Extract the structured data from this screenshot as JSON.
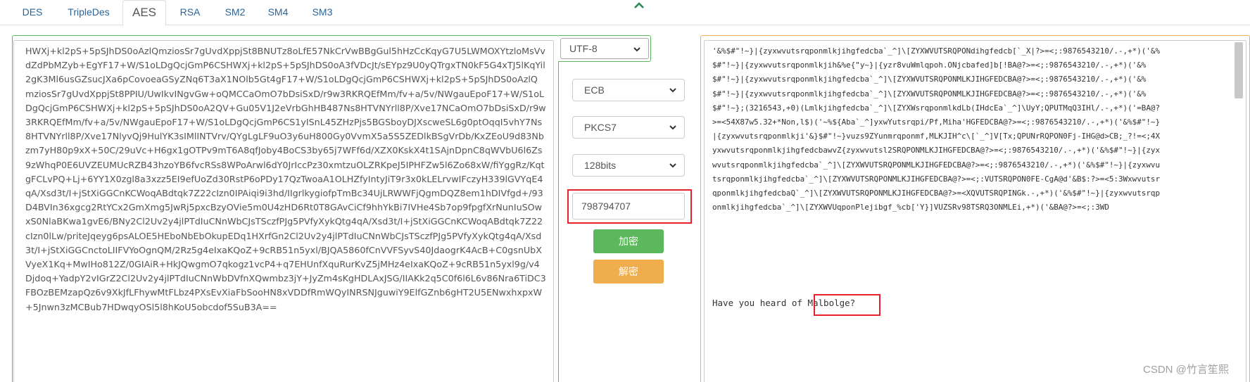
{
  "tabs": [
    {
      "label": "DES"
    },
    {
      "label": "TripleDes"
    },
    {
      "label": "AES",
      "active": true
    },
    {
      "label": "RSA"
    },
    {
      "label": "SM2"
    },
    {
      "label": "SM4"
    },
    {
      "label": "SM3"
    }
  ],
  "icons": {
    "collapse": "chevron-up-icon",
    "dropdown": "chevron-down-icon"
  },
  "colors": {
    "link": "#2a6496",
    "encrypt": "#5cb85c",
    "decrypt": "#f0ad4e",
    "highlight": "#e8222d"
  },
  "input": {
    "ciphertext": "HWXj+kl2pS+5pSJhDS0oAzlQmziosSr7gUvdXppjSt8BNUTz8oLfE57NkCrVwBBgGul5hHzCcKqyG7U5LWMOXYtzloMsVvdZdPbMZyb+EgYF17+W/S1oLDgQcjGmP6CSHWXj+kl2pS+5pSJhDS0oA3fVDcJt/sEYpz9U0yQTrgxTN0kF5G4xTJ5lKqYil2gK3Ml6usGZsucJXa6pCovoeaGSyZNq6T3aX1NOlb5Gt4gF17+W/S1oLDgQcjGmP6CSHWXj+kl2pS+5pSJhDS0oAzlQmziosSr7gUvdXppjSt8PPIU/UwIkvINgvGw+oQMCCaOmO7bDsiSxD/r9w3RKRQEfMm/fv+a/5v/NWgauEpoF17+W/S1oLDgQcjGmP6CSHWXj+kl2pS+5pSJhDS0oA2QV+Gu05V1J2eVrbGhHB487Ns8HTVNYrll8P/Xve17NCaOmO7bDsiSxD/r9w3RKRQEfMm/fv+a/5v/NWgauEpoF17+W/S1oLDgQcjGmP6CS1yISnL45ZHzPjs5BGSboyDJXscweSL6g0ptOqqI5vhY7Ns8HTVNYrll8P/Xve17NlyvQj9HulYK3sIMlINTVrv/QYgLgLF9uO3y6uH800Gy0VvmX5a5S5ZEDlkBSgVrDb/KxZEoU9d83Nbzm7yH80p9xX+50C/29uVc+H6gx1gOTPv9mT6A8qfJoby4BoCS3by65j7WFf6d/XZX0KskX4t1SAjnDpnC8qWVbU6l6Zs9zWhqP0E6UVZEUMUcRZB43hzoYB6fvcRSs8WPoArwl6dY0JrIccPz30xmtzuOLZRKpeJ5IPHFZw5l6Zo68xW/fiYggRz/KqtgFCLvPQ+Lj+6YY1X0zgl8a3xzz5EI9efUoZd30RstP6oPDy17QzTwoaA1OLHZfyIntyJiT9r3x0kLELrvwIFczyH339lGVYqE4qA/Xsd3t/I+jStXiGGCnKCWoqABdtqk7Z22cIzn0IPAiqi9i3hd/IIgrlkygiofpTmBc34UjLRWWFjQgmDQZ8em1hDIVfgd+/93D4BVIn36xgcg2RtYCx2GmXmg5JwRj5pxcBzyOVie5m0U4zHD6Rt0T8GAvCiCf9hhYkBi7IVHe4Sb7op9fpgfXrNunIuSOwxS0NlaBKwa1gvE6/BNy2Cl2Uv2y4jlPTdIuCNnWbCJsTSczfPJg5PVfyXykQtg4qA/Xsd3t/I+jStXiGGCnKCWoqABdtqk7Z22cIzn0lLw/priteJqeyg6psALOE5HEboNbEbOkupEDq1HXrfGn2Cl2Uv2y4jlPTdIuCNnWbCJsTSczfPJg5PVfyXykQtg4qA/Xsd3t/I+jStXiGGCnctoLIIFVYoOgnQM/2Rz5g4eIxaKQoZ+9cRB51n5yxl/BJQA5860fCnVVFSyvS40JdaogrK4AcB+C0gsnUbXVyeX1Kq+MwIHo812Z/0GIAiR+HkJQwgmO7qkogz1vcP4+q7EHUnfXquRurKvZ5jMHz4eIxaKQoZ+9cRB51n5yxl9g/v4Djdoq+YadpY2vIGrZ2Cl2Uv2y4jlPTdIuCNnWbDVfnXQwmbz3jY+JyZm4sKgHDLAxJSG/IIAKk2q5C0f6l6L6v86Nra6TiDC3FBOzBEMzapQz6v9XkJfLFhywMtFLbz4PXsEvXiaFbSooHN8xVDDfRmWQyINRSNJguwiY9ElfGZnb6gHT2U5ENwxhxpxW+5Jnwn3zMCBub7HDwqyOSl5l8hKoU5obcdof5SuB3A==",
    "charset": "UTF-8",
    "mode": "ECB",
    "padding": "PKCS7",
    "bits": "128bits",
    "key": "798794707"
  },
  "buttons": {
    "encrypt": "加密",
    "decrypt": "解密"
  },
  "output": {
    "plaintext": "'&%$#\"!~}|{zyxwvutsrqponmlkjihgfedcba`_^]\\[ZYXWVUTSRQPONdihgfedcb[`_X|?>=<;:9876543210/.-,+*)('&%$#\"!~}|{zyxwvutsrqponmlkjih&%e{\"y~}|{yzr8vuWmlqpoh.ONjcbafed]b[!BA@?>=<;:9876543210/.-,+*)('&%$#\"!~}|{zyxwvutsrqponmlkjihgfedcba`_^]\\[ZYXWVUTSRQPONMLKJIHGFEDCBA@?>=<;:9876543210/.-,+*)('&%$#\"!~}|{zyxwvutsrqponmlkjihgfedcba`_^]\\[ZYXWVUTSRQPONMLKJIHGFEDCBA@?>=<;:9876543210/.-,+*)('&%$#\"!~};(3216543,+0)(Lmlkjihgfedcba`_^]\\[ZYXWsrqponmlkdLb(IHdcEa`_^]\\UyY;QPUTMqQ3IHl/.-,+*)('=BA@?>=<54X87w5.32+*Non,l$)('~%${Aba`_^]yxwYutsrqpi/Pf,Miha'HGFEDCBA@?>=<;:9876543210/.-,+*)('&%$#\"!~}|{zyxwvutsrqponmlkji'&}$#\"!~}vuzs9ZYunmrqponmf,MLKJIH^c\\[`_^]V[Tx;QPUNrRQPON0Fj-IHG@d>CB;_?!=<;4XyxwvutsrqponmlkjihgfedcbawvZ{zyxwvutsl2SRQPONMLKJIHGFEDCBA@?>=<;:9876543210/.-,+*)('&%$#\"!~}|{zyxwvutsrqponmlkjihgfedcba`_^]\\[ZYXWVUTSRQPONMLKJIHGFEDCBA@?>=<;:9876543210/.-,+*)('&%$#\"!~}|{zyxwvutsrqponmlkjihgfedcba`_^]\\[ZYXWVUTSRQPONMLKJIHGFEDCBA@?>=<;:VUTSRQPON0FE-CgA@d'&B$:?>=<5:3WxwvutsrqponmlkjihgfedcbaQ`_^]\\[ZYXWVUTSRQPONMLKJIHGFEDCBA@?>=<XQVUTSRQPINGk.-,+*)('&%$#\"!~}|{zyxwvutsrqponmlkjihgfedcba`_^]\\[ZYXWVUqponPlejibgf_%cb['Y}]VUZSRv98TSRQ3ONMLEi,+*)('&BA@?>=<;:3WD",
    "question_prefix": "Have you heard of ",
    "answer": "Malbolge?"
  },
  "watermark": "CSDN @竹言笙熙"
}
